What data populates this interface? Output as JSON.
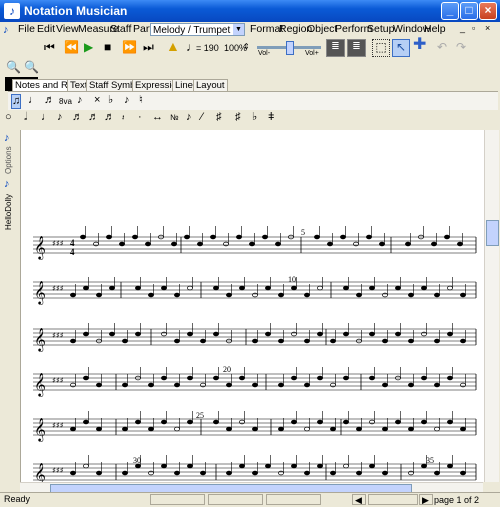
{
  "window": {
    "title": "Notation Musician"
  },
  "menu": {
    "items": [
      "File",
      "Edit",
      "View",
      "Measure",
      "Staff",
      "Part",
      "Format",
      "Region",
      "Object",
      "Perform",
      "Setup",
      "Window",
      "Help"
    ],
    "part_select": "Melody / Trumpet"
  },
  "toolbar": {
    "tempo_value": "= 190",
    "zoom_value": "100%",
    "vol_min_label": "Vol-",
    "vol_max_label": "Vol+"
  },
  "palette_tabs": [
    "Notes and Rests",
    "Text",
    "Staff Symbols",
    "Expressions",
    "Lines",
    "Layout"
  ],
  "sidepanel": {
    "tab_options": "Options",
    "tab_hellodolly": "HelloDolly"
  },
  "score": {
    "measure_numbers": [
      "5",
      "10",
      "20",
      "25",
      "30",
      "35"
    ],
    "time_signature_top": "4",
    "time_signature_bottom": "4"
  },
  "status": {
    "left": "Ready",
    "page": "page 1 of 2"
  }
}
